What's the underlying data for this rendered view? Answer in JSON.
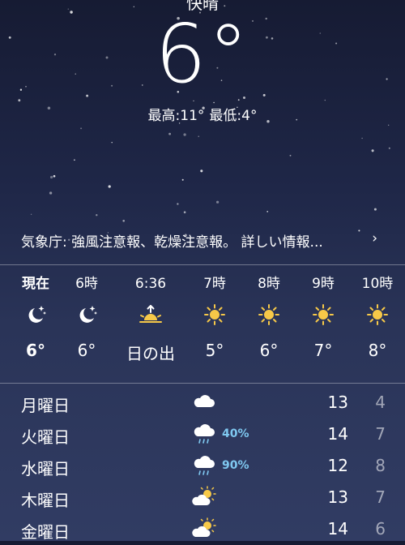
{
  "current": {
    "condition": "快晴",
    "temperature": "6°",
    "high": "最高:11°",
    "low": "最低:4°"
  },
  "alert": {
    "text": "気象庁: 強風注意報、乾燥注意報。 詳しい情報...",
    "chevron": "›"
  },
  "hourly": [
    {
      "time": "現在",
      "icon": "moon-stars-icon",
      "temp": "6°"
    },
    {
      "time": "6時",
      "icon": "moon-stars-icon",
      "temp": "6°"
    },
    {
      "time": "6:36",
      "icon": "sunrise-icon",
      "temp": "日の出"
    },
    {
      "time": "7時",
      "icon": "sun-icon",
      "temp": "5°"
    },
    {
      "time": "8時",
      "icon": "sun-icon",
      "temp": "6°"
    },
    {
      "time": "9時",
      "icon": "sun-icon",
      "temp": "7°"
    },
    {
      "time": "10時",
      "icon": "sun-icon",
      "temp": "8°"
    }
  ],
  "daily": [
    {
      "day": "月曜日",
      "icon": "cloud-icon",
      "precip": "",
      "high": "13",
      "low": "4"
    },
    {
      "day": "火曜日",
      "icon": "cloud-rain-icon",
      "precip": "40%",
      "high": "14",
      "low": "7"
    },
    {
      "day": "水曜日",
      "icon": "cloud-rain-icon",
      "precip": "90%",
      "high": "12",
      "low": "8"
    },
    {
      "day": "木曜日",
      "icon": "partly-sunny-icon",
      "precip": "",
      "high": "13",
      "low": "7"
    },
    {
      "day": "金曜日",
      "icon": "partly-sunny-icon",
      "precip": "",
      "high": "14",
      "low": "6"
    }
  ],
  "colors": {
    "background_top": "#161b33",
    "background_bottom": "#313c63",
    "sun": "#f7c948",
    "precip": "#7fc8f0"
  }
}
